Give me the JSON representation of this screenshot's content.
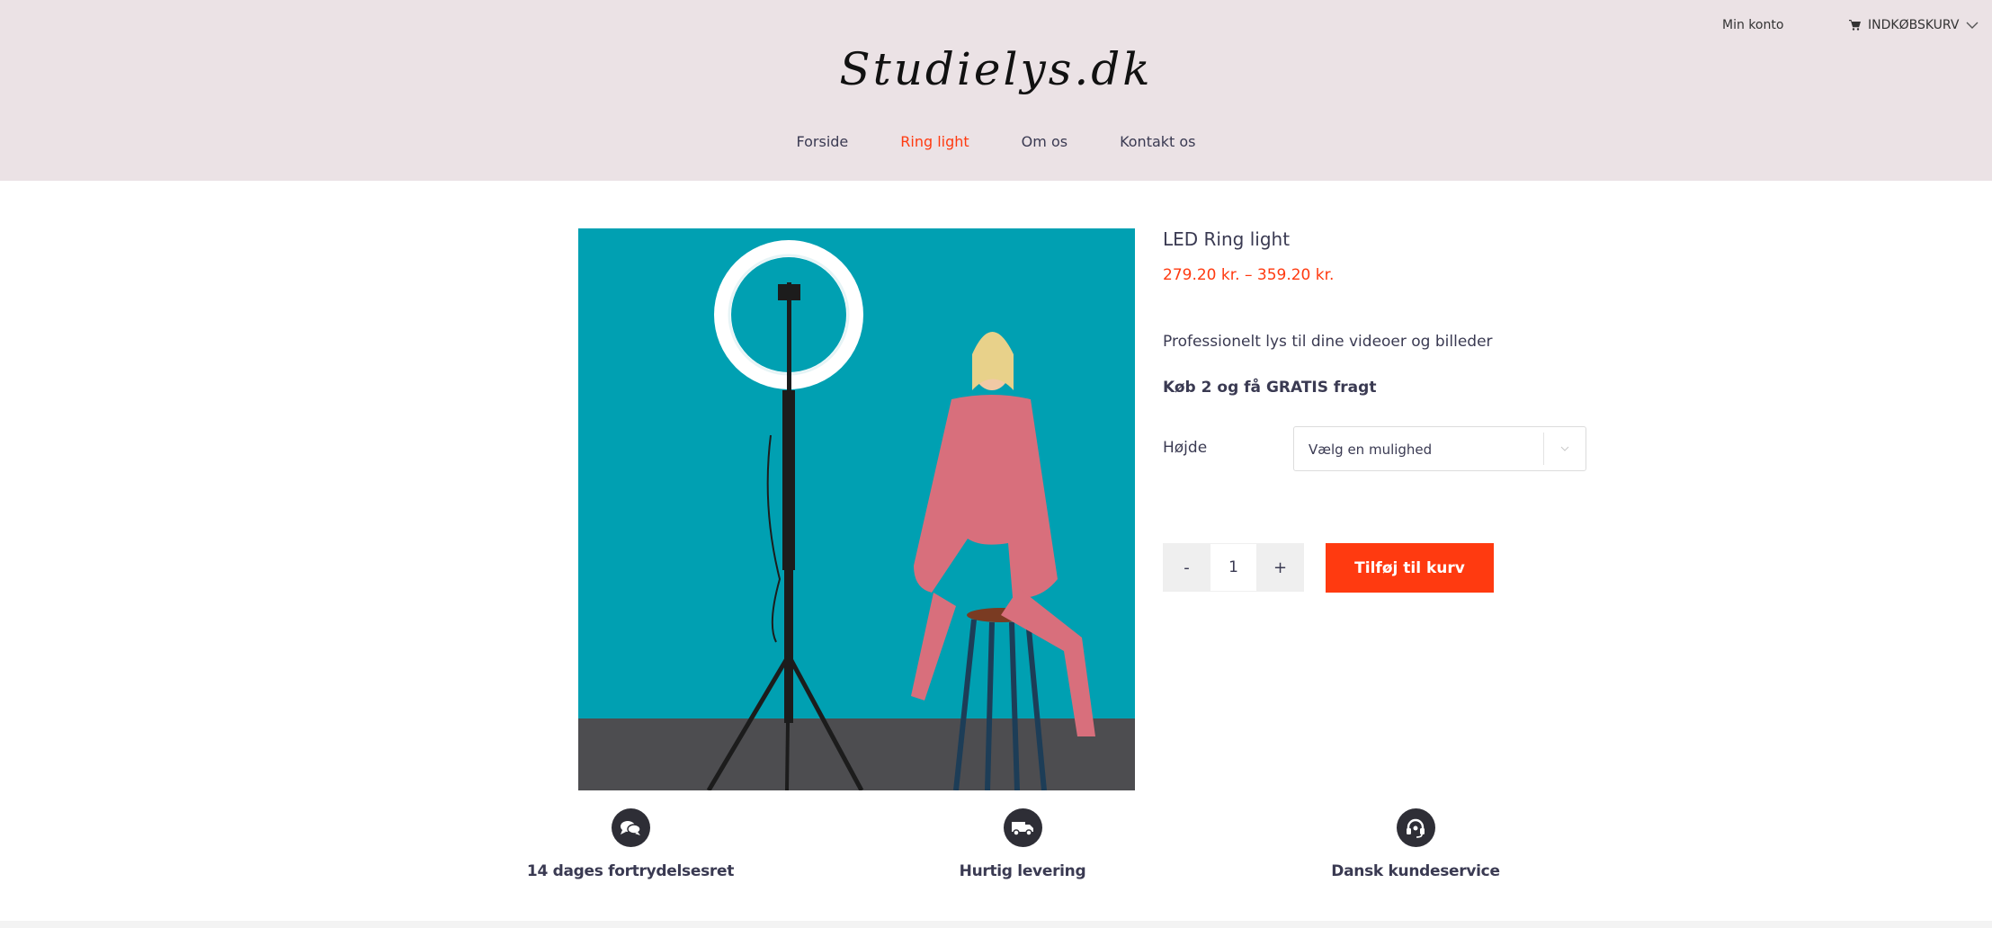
{
  "header": {
    "account_label": "Min konto",
    "cart_label": "INDKØBSKURV",
    "logo_text": "Studielys.dk",
    "nav": [
      {
        "label": "Forside",
        "active": false
      },
      {
        "label": "Ring light",
        "active": true
      },
      {
        "label": "Om os",
        "active": false
      },
      {
        "label": "Kontakt os",
        "active": false
      }
    ]
  },
  "product": {
    "title": "LED Ring light",
    "price": "279.20 kr. – 359.20 kr.",
    "description": "Professionelt lys til dine videoer og billeder",
    "promo": "Køb 2 og få GRATIS fragt",
    "variant_label": "Højde",
    "variant_select_value": "Vælg en mulighed",
    "quantity": "1",
    "qty_minus": "-",
    "qty_plus": "+",
    "add_to_cart_label": "Tilføj til kurv"
  },
  "features": [
    {
      "label": "14 dages fortrydelsesret",
      "icon": "chat-bubbles-icon"
    },
    {
      "label": "Hurtig levering",
      "icon": "delivery-truck-icon"
    },
    {
      "label": "Dansk kundeservice",
      "icon": "headset-icon"
    }
  ],
  "colors": {
    "accent": "#ff3a10",
    "header_bg": "#ebe2e5",
    "text": "#3a3a52",
    "image_bg": "#00a0b2"
  }
}
